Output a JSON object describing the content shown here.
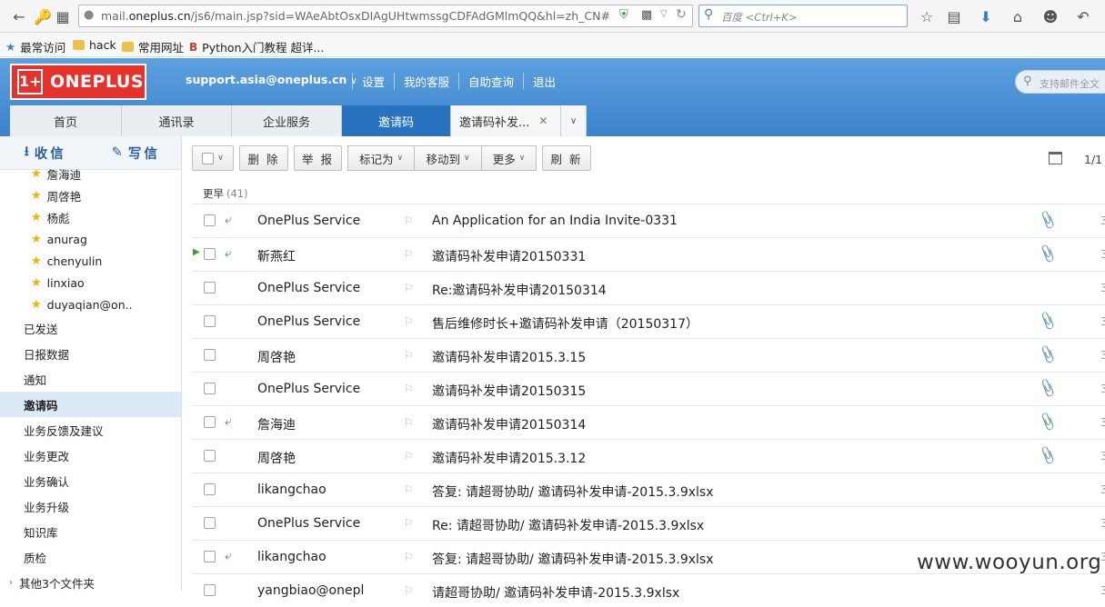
{
  "browser": {
    "url_prefix": "mail.",
    "url_domain": "oneplus.cn",
    "url_rest": "/js6/main.jsp?sid=WAeAbtOsxDIAgUHtwmssgCDFAdGMlmQQ&hl=zh_CN#module",
    "search_placeholder": "百度 <Ctrl+K>",
    "bookmarks": [
      "最常访问",
      "hack",
      "常用网址",
      "Python入门教程 超详..."
    ]
  },
  "header": {
    "logo_text": "ONEPLUS",
    "logo_mark": "1+",
    "account": "support.asia@oneplus.cn",
    "links": [
      "设置",
      "我的客服",
      "自助查询",
      "退出"
    ],
    "search_placeholder": "支持邮件全文"
  },
  "tabs": [
    {
      "label": "首页"
    },
    {
      "label": "通讯录"
    },
    {
      "label": "企业服务"
    },
    {
      "label": "邀请码"
    },
    {
      "label": "邀请码补发..."
    }
  ],
  "sidebar": {
    "receive": "收信",
    "compose": "写信",
    "contacts": [
      "詹海迪",
      "周啓艳",
      "杨彪",
      "anurag",
      "chenyulin",
      "linxiao",
      "duyaqian@on.."
    ],
    "folders": [
      "已发送",
      "日报数据",
      "通知",
      "邀请码",
      "业务反馈及建议",
      "业务更改",
      "业务确认",
      "业务升级",
      "知识库",
      "质检",
      "其他3个文件夹"
    ]
  },
  "toolbar": {
    "delete": "删 除",
    "report": "举 报",
    "mark_as": "标记为",
    "move_to": "移动到",
    "more": "更多",
    "refresh": "刷 新",
    "pager": "1/1"
  },
  "group": {
    "title": "更早",
    "count": "(41)"
  },
  "mails": [
    {
      "sender": "OnePlus Service",
      "subject": "An Application for an India Invite-0331",
      "replied": true,
      "attach": true,
      "date": "3"
    },
    {
      "sender": "靳燕红",
      "subject": "邀请码补发申请20150331",
      "replied": true,
      "attach": true,
      "date": "3"
    },
    {
      "sender": "OnePlus Service",
      "subject": "Re:邀请码补发申请20150314",
      "replied": false,
      "attach": false,
      "date": "3"
    },
    {
      "sender": "OnePlus Service",
      "subject": "售后维修时长+邀请码补发申请（20150317）",
      "replied": false,
      "attach": true,
      "date": "3"
    },
    {
      "sender": "周啓艳",
      "subject": "邀请码补发申请2015.3.15",
      "replied": false,
      "attach": true,
      "date": "3"
    },
    {
      "sender": "OnePlus Service",
      "subject": "邀请码补发申请20150315",
      "replied": false,
      "attach": true,
      "date": "3"
    },
    {
      "sender": "詹海迪",
      "subject": "邀请码补发申请20150314",
      "replied": true,
      "attach": true,
      "date": "3"
    },
    {
      "sender": "周啓艳",
      "subject": "邀请码补发申请2015.3.12",
      "replied": false,
      "attach": true,
      "date": "3"
    },
    {
      "sender": "likangchao",
      "subject": "答复: 请超哥协助/ 邀请码补发申请-2015.3.9xlsx",
      "replied": false,
      "attach": false,
      "date": "3"
    },
    {
      "sender": "OnePlus Service",
      "subject": "Re: 请超哥协助/ 邀请码补发申请-2015.3.9xlsx",
      "replied": false,
      "attach": false,
      "date": "3"
    },
    {
      "sender": "likangchao",
      "subject": "答复: 请超哥协助/ 邀请码补发申请-2015.3.9xlsx",
      "replied": true,
      "attach": false,
      "date": "3"
    },
    {
      "sender": "yangbiao@onepl",
      "subject": "请超哥协助/ 邀请码补发申请-2015.3.9xlsx",
      "replied": false,
      "attach": false,
      "date": "3"
    }
  ],
  "watermark": "www.wooyun.org"
}
